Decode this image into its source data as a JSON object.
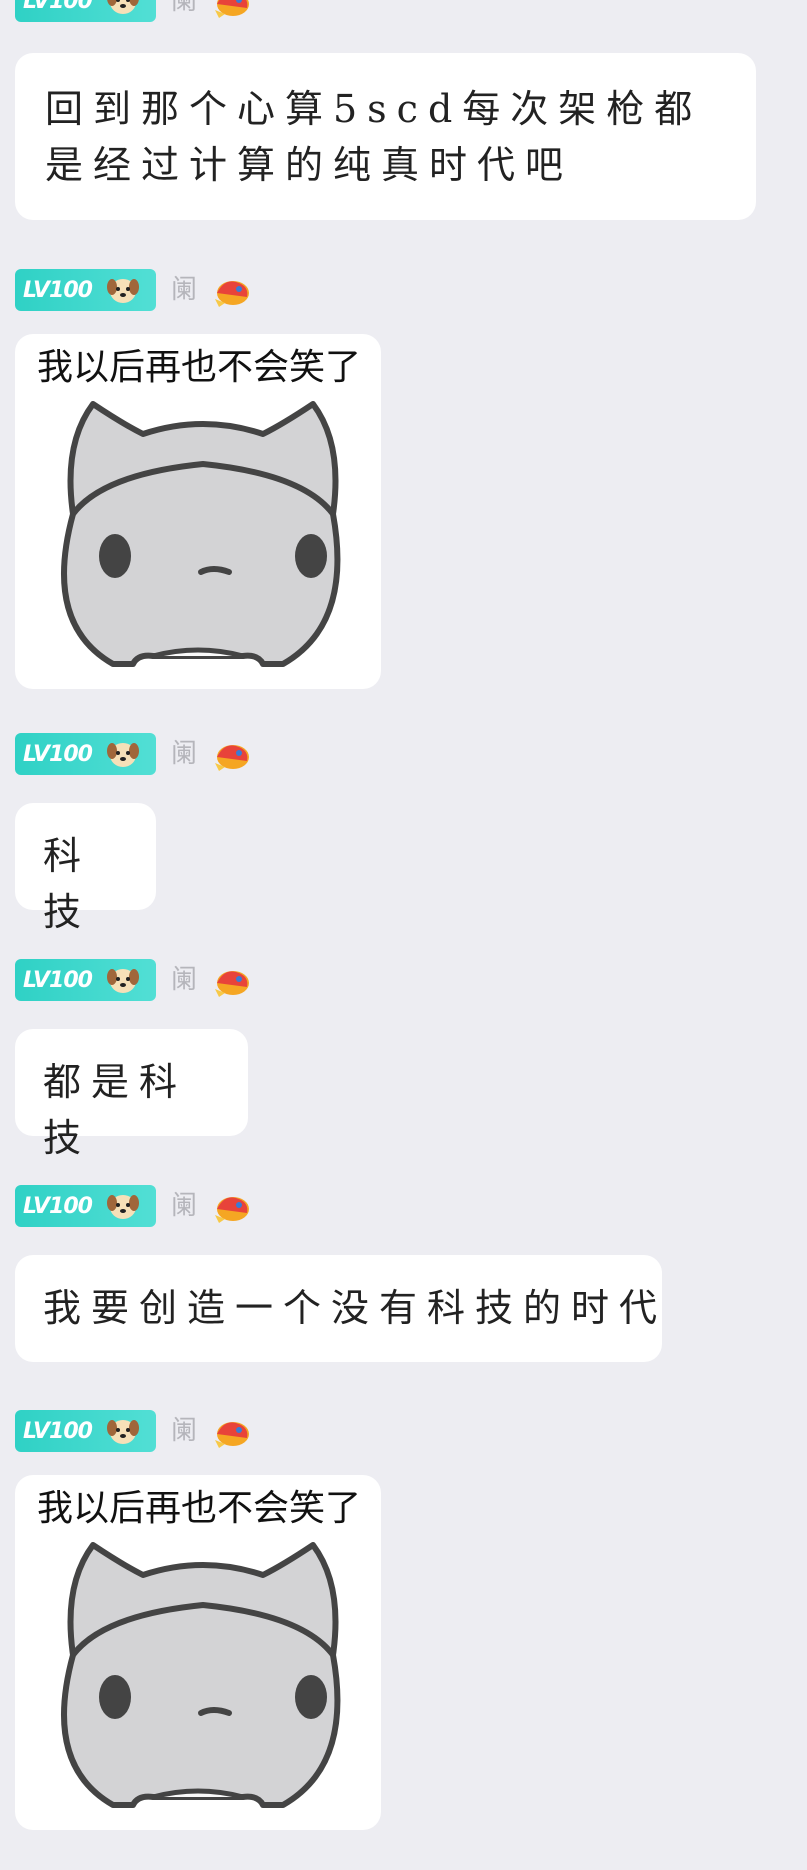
{
  "badge": {
    "level_text": "LV100",
    "mark_char": "阑"
  },
  "messages": [
    {
      "type": "text",
      "text": "回到那个心算5scd每次架枪都是经过计算的纯真时代吧"
    },
    {
      "type": "sticker",
      "caption": "我以后再也不会笑了"
    },
    {
      "type": "text",
      "text": "科技"
    },
    {
      "type": "text",
      "text": "都是科技"
    },
    {
      "type": "text",
      "text": "我要创造一个没有科技的时代"
    },
    {
      "type": "sticker",
      "caption": "我以后再也不会笑了"
    }
  ],
  "colors": {
    "background": "#ededf2",
    "bubble": "#ffffff",
    "badge_teal": "#2fd1c5"
  }
}
